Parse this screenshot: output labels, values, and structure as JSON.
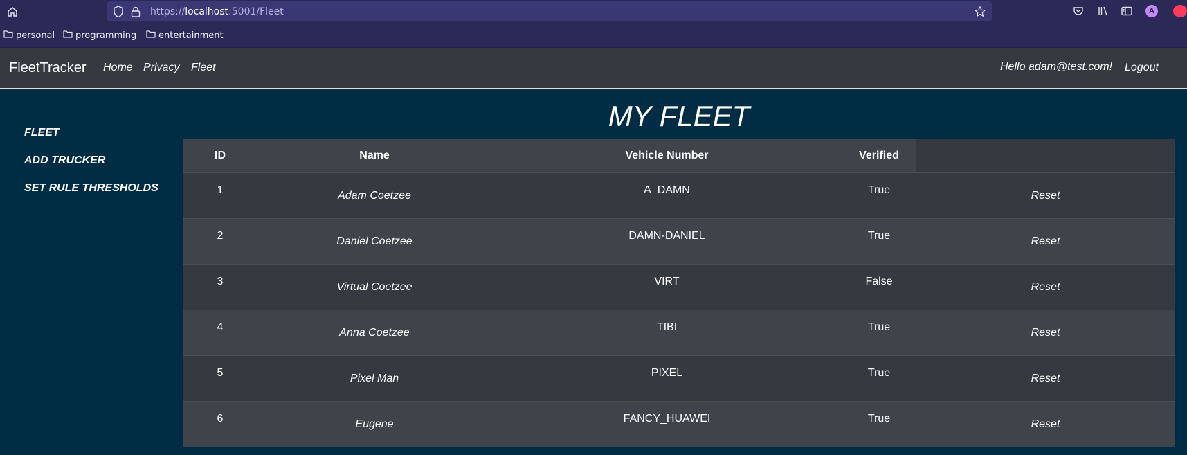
{
  "browser": {
    "url_prefix": "https://",
    "url_host": "localhost",
    "url_rest": ":5001/Fleet",
    "bookmarks": [
      "personal",
      "programming",
      "entertainment"
    ],
    "profile_initial": "A"
  },
  "nav": {
    "brand": "FleetTracker",
    "links": [
      "Home",
      "Privacy",
      "Fleet"
    ],
    "greeting": "Hello adam@test.com!",
    "logout": "Logout"
  },
  "sidebar": {
    "items": [
      "FLEET",
      "ADD TRUCKER",
      "SET RULE THRESHOLDS"
    ]
  },
  "page": {
    "title": "MY FLEET"
  },
  "table": {
    "headers": [
      "ID",
      "Name",
      "Vehicle Number",
      "Verified"
    ],
    "action_label": "Reset",
    "rows": [
      {
        "id": "1",
        "name": "Adam Coetzee",
        "vehicle": "A_DAMN",
        "verified": "True"
      },
      {
        "id": "2",
        "name": "Daniel Coetzee",
        "vehicle": "DAMN-DANIEL",
        "verified": "True"
      },
      {
        "id": "3",
        "name": "Virtual Coetzee",
        "vehicle": "VIRT",
        "verified": "False"
      },
      {
        "id": "4",
        "name": "Anna Coetzee",
        "vehicle": "TIBI",
        "verified": "True"
      },
      {
        "id": "5",
        "name": "Pixel Man",
        "vehicle": "PIXEL",
        "verified": "True"
      },
      {
        "id": "6",
        "name": "Eugene",
        "vehicle": "FANCY_HUAWEI",
        "verified": "True"
      }
    ]
  }
}
